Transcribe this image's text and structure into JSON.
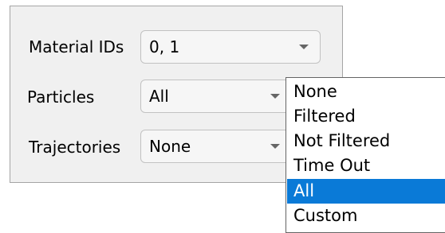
{
  "form": {
    "material_ids": {
      "label": "Material IDs",
      "value": "0, 1"
    },
    "particles": {
      "label": "Particles",
      "value": "All"
    },
    "trajectories": {
      "label": "Trajectories",
      "value": "None"
    }
  },
  "dropdown": {
    "options": [
      "None",
      "Filtered",
      "Not Filtered",
      "Time Out",
      "All",
      "Custom"
    ],
    "selected": "All"
  },
  "colors": {
    "selection": "#0a7ad7",
    "panel_background": "#f0f0f0"
  },
  "icons": {
    "combo_arrow": "chevron-down-icon"
  }
}
